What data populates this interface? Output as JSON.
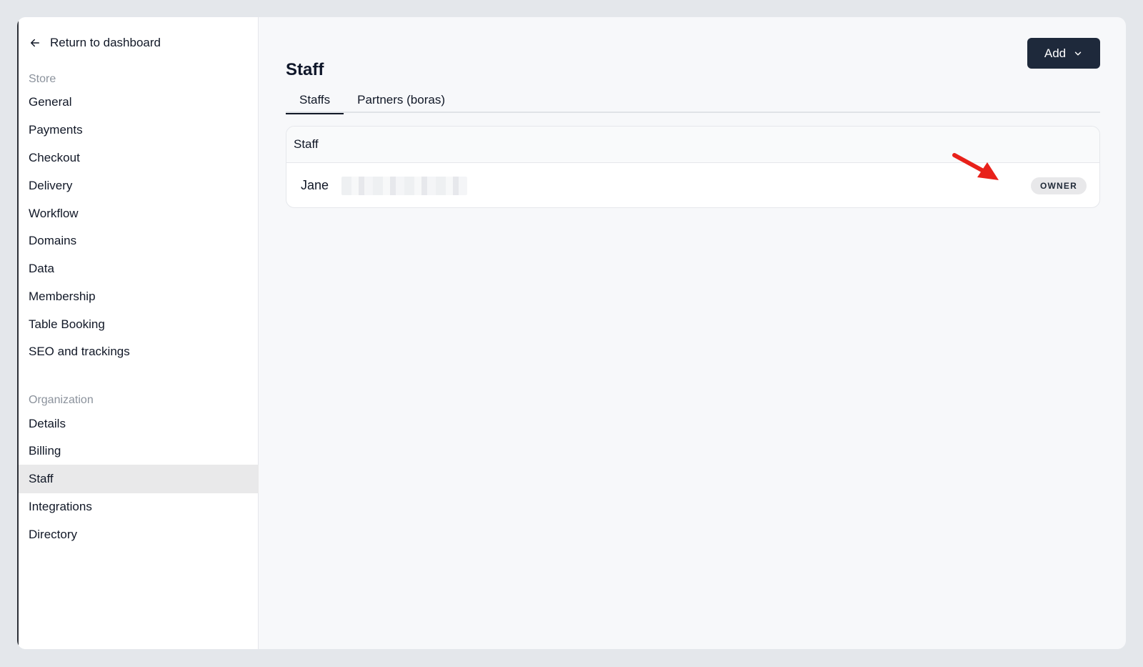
{
  "sidebar": {
    "back_label": "Return to dashboard",
    "store_section": "Store",
    "store_items": [
      "General",
      "Payments",
      "Checkout",
      "Delivery",
      "Workflow",
      "Domains",
      "Data",
      "Membership",
      "Table Booking",
      "SEO and trackings"
    ],
    "org_section": "Organization",
    "org_items": [
      "Details",
      "Billing",
      "Staff",
      "Integrations",
      "Directory"
    ],
    "active_item": "Staff"
  },
  "header": {
    "title": "Staff",
    "add_label": "Add"
  },
  "tabs": [
    "Staffs",
    "Partners (boras)"
  ],
  "active_tab": "Staffs",
  "card": {
    "title": "Staff",
    "rows": [
      {
        "name": "Jane",
        "role": "OWNER"
      }
    ]
  },
  "colors": {
    "primary_button": "#1e293b",
    "annotation_arrow": "#e8211a"
  }
}
